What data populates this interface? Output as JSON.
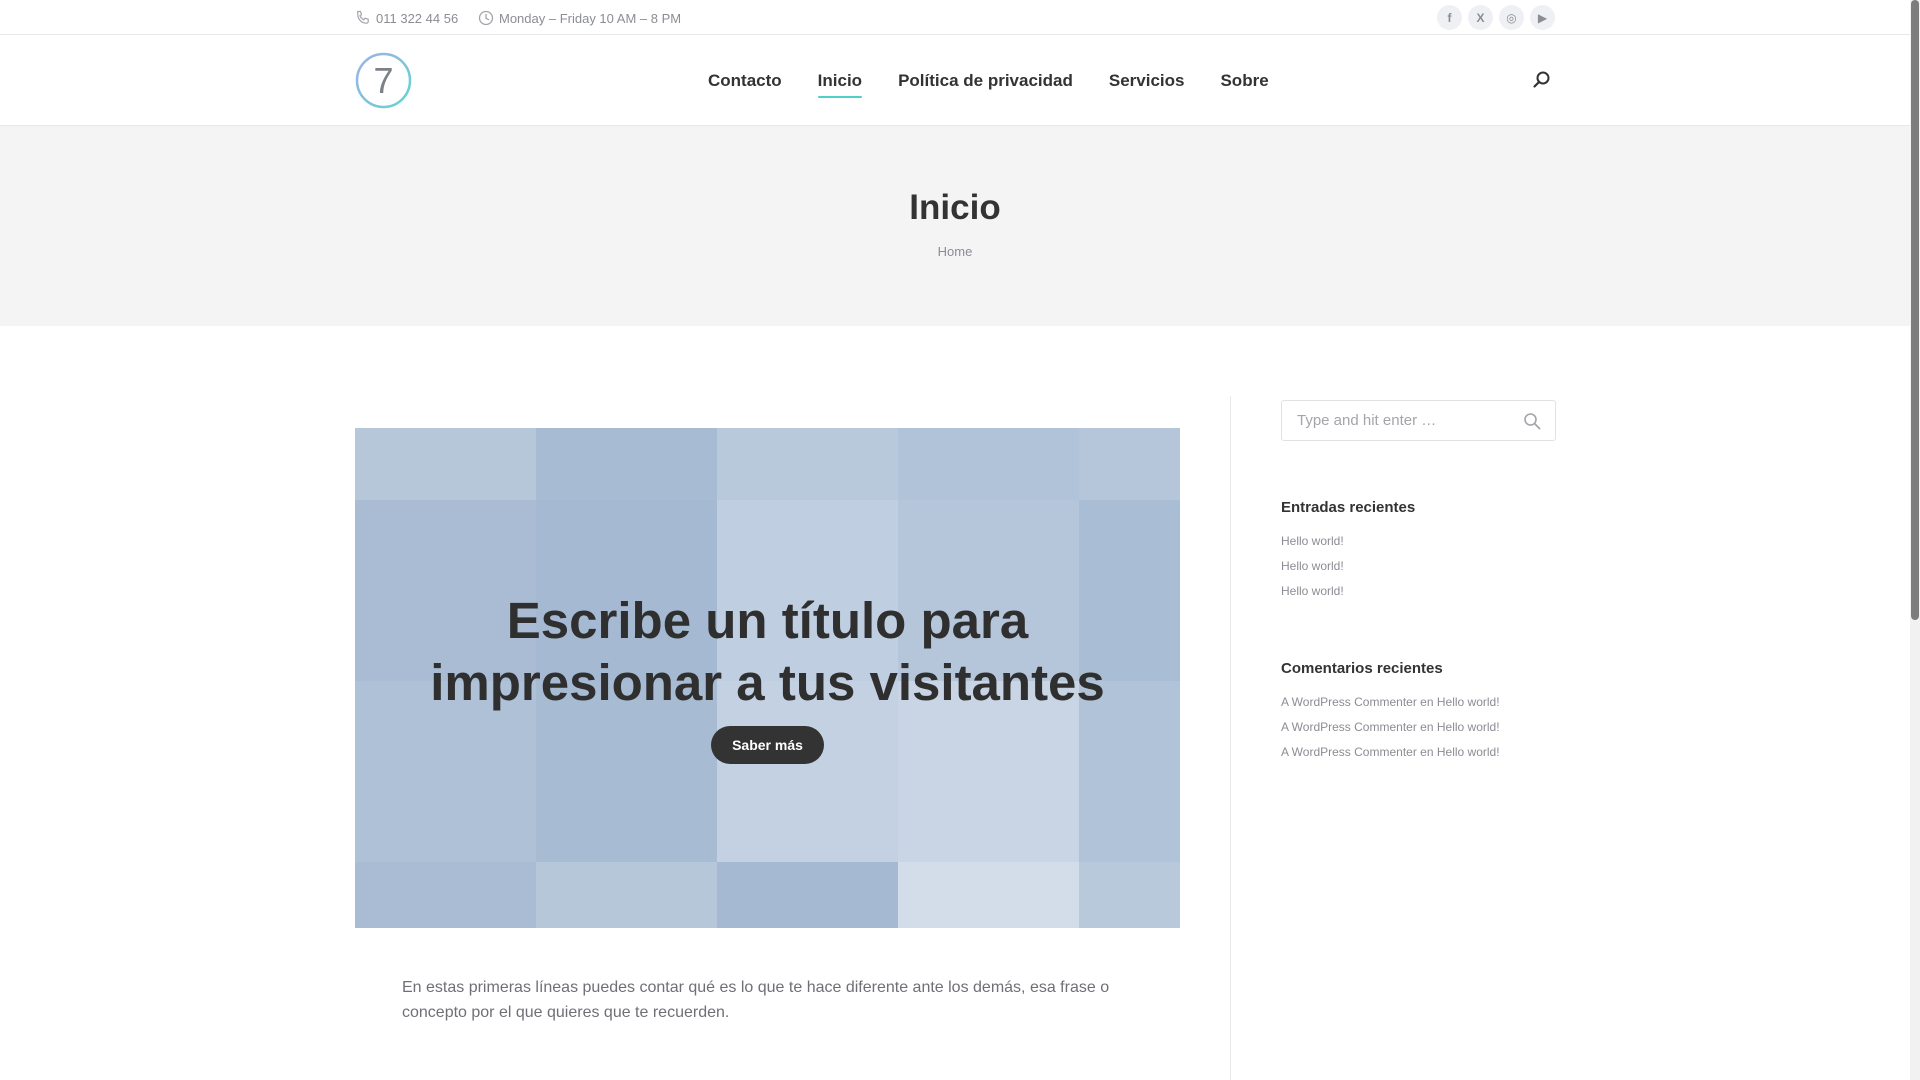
{
  "topbar": {
    "phone": "011 322 44 56",
    "hours": "Monday – Friday 10 AM – 8 PM",
    "social": [
      {
        "icon": "facebook-icon",
        "glyph": "f"
      },
      {
        "icon": "x-icon",
        "glyph": "X"
      },
      {
        "icon": "instagram-icon",
        "glyph": "◎"
      },
      {
        "icon": "youtube-icon",
        "glyph": "▶"
      }
    ]
  },
  "logo": {
    "number": "7"
  },
  "nav": {
    "items": [
      {
        "label": "Contacto"
      },
      {
        "label": "Inicio"
      },
      {
        "label": "Política de privacidad"
      },
      {
        "label": "Servicios"
      },
      {
        "label": "Sobre"
      }
    ],
    "active": "Inicio"
  },
  "page": {
    "title": "Inicio",
    "breadcrumb": "Home"
  },
  "hero": {
    "heading": "Escribe un título para impresionar a tus visitantes",
    "button": "Saber más"
  },
  "intro": "En estas primeras líneas puedes contar qué es lo que te hace diferente ante los demás, esa frase o concepto por el que quieres que te recuerden.",
  "sidebar": {
    "search_placeholder": "Type and hit enter …",
    "recent_posts_title": "Entradas recientes",
    "recent_posts": [
      "Hello world!",
      "Hello world!",
      "Hello world!"
    ],
    "recent_comments_title": "Comentarios recientes",
    "recent_comments": [
      {
        "author": "A WordPress Commenter",
        "sep": "en",
        "post": "Hello world!"
      },
      {
        "author": "A WordPress Commenter",
        "sep": "en",
        "post": "Hello world!"
      },
      {
        "author": "A WordPress Commenter",
        "sep": "en",
        "post": "Hello world!"
      }
    ]
  },
  "colors": {
    "accent": "#4fd0c8",
    "text": "#333333",
    "muted": "#8b8d94",
    "hero_tile_base": "#b6c6da"
  }
}
